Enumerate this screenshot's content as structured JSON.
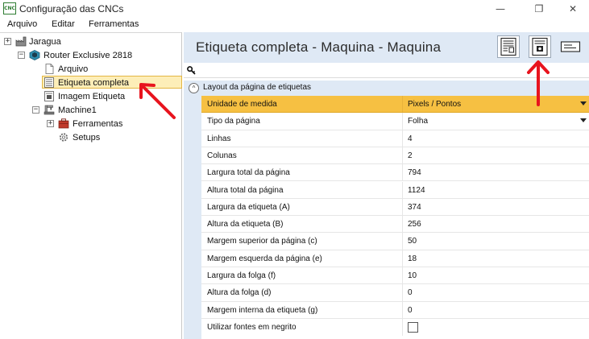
{
  "window": {
    "app_icon_text": "CNC",
    "title": "Configuração das CNCs",
    "minimize_glyph": "—",
    "maximize_glyph": "❐",
    "close_glyph": "✕"
  },
  "menu": {
    "items": [
      "Arquivo",
      "Editar",
      "Ferramentas"
    ]
  },
  "tree": {
    "items": [
      {
        "label": "Jaragua",
        "icon": "factory-icon",
        "expander": "+"
      },
      {
        "label": "Router Exclusive 2818",
        "icon": "router-icon",
        "expander": "−"
      },
      {
        "label": "Arquivo",
        "icon": "file-icon"
      },
      {
        "label": "Etiqueta completa",
        "icon": "label-sheet-icon",
        "selected": true
      },
      {
        "label": "Imagem Etiqueta",
        "icon": "label-image-icon"
      },
      {
        "label": "Machine1",
        "icon": "machine-icon",
        "expander": "−"
      },
      {
        "label": "Ferramentas",
        "icon": "tools-icon",
        "expander": "+"
      },
      {
        "label": "Setups",
        "icon": "gear-icon"
      }
    ]
  },
  "header": {
    "title": "Etiqueta completa - Maquina - Maquina"
  },
  "search": {
    "icon": "key-icon"
  },
  "section": {
    "label": "Layout da página de etiquetas",
    "collapse_glyph": "^"
  },
  "properties": [
    {
      "name": "Unidade de medida",
      "value": "Pixels / Pontos",
      "type": "dropdown"
    },
    {
      "name": "Tipo da página",
      "value": "Folha",
      "type": "dropdown"
    },
    {
      "name": "Linhas",
      "value": "4"
    },
    {
      "name": "Colunas",
      "value": "2"
    },
    {
      "name": "Largura total da página",
      "value": "794"
    },
    {
      "name": "Altura total da página",
      "value": "1124"
    },
    {
      "name": "Largura da etiqueta (A)",
      "value": "374"
    },
    {
      "name": "Altura da etiqueta (B)",
      "value": "256"
    },
    {
      "name": "Margem superior da página (c)",
      "value": "50"
    },
    {
      "name": "Margem esquerda da página (e)",
      "value": "18"
    },
    {
      "name": "Largura da folga (f)",
      "value": "10"
    },
    {
      "name": "Altura da folga (d)",
      "value": "0"
    },
    {
      "name": "Margem interna da etiqueta (g)",
      "value": "0"
    },
    {
      "name": "Utilizar fontes em negrito",
      "value": "",
      "type": "checkbox",
      "checked": false
    }
  ],
  "colors": {
    "accent_header": "#dfe9f5",
    "selected_row": "#f6c042",
    "tree_selection": "#fdeeb8",
    "annotation_arrow": "#e8141e"
  }
}
